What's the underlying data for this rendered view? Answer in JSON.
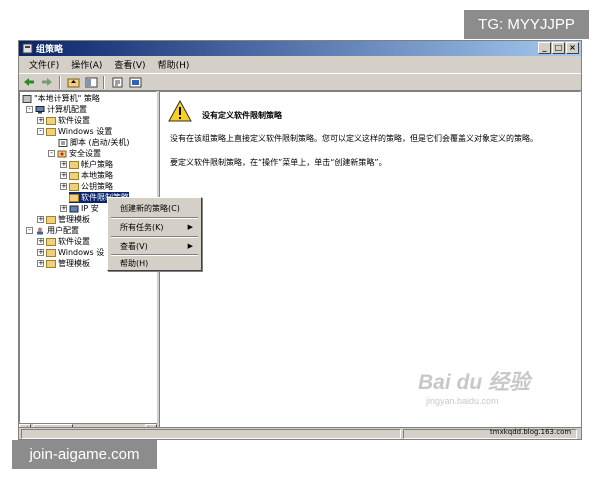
{
  "window": {
    "title": "组策略",
    "controls": [
      "_",
      "□",
      "×"
    ]
  },
  "menubar": {
    "items": [
      "文件(F)",
      "操作(A)",
      "查看(V)",
      "帮助(H)"
    ]
  },
  "toolbar": {
    "icons": [
      "back-arrow-icon",
      "forward-arrow-icon",
      "folder-up-icon",
      "show-tree-icon",
      "properties-icon",
      "help-icon"
    ]
  },
  "tree": {
    "items": [
      {
        "label": "\"本地计算机\" 策略",
        "expander": "",
        "icon": "policy-icon"
      },
      {
        "label": "计算机配置",
        "expander": "-",
        "icon": "computer-icon"
      },
      {
        "label": "软件设置",
        "expander": "+",
        "icon": "folder-icon"
      },
      {
        "label": "Windows 设置",
        "expander": "-",
        "icon": "folder-icon"
      },
      {
        "label": "脚本 (启动/关机)",
        "expander": "",
        "icon": "script-icon"
      },
      {
        "label": "安全设置",
        "expander": "-",
        "icon": "security-icon"
      },
      {
        "label": "帐户策略",
        "expander": "+",
        "icon": "folder-icon"
      },
      {
        "label": "本地策略",
        "expander": "+",
        "icon": "folder-icon"
      },
      {
        "label": "公钥策略",
        "expander": "+",
        "icon": "folder-icon"
      },
      {
        "label": "软件限制策略",
        "expander": "",
        "icon": "folder-icon",
        "selected": true
      },
      {
        "label": "IP 安",
        "expander": "+",
        "icon": "ip-security-icon"
      },
      {
        "label": "管理模板",
        "expander": "+",
        "icon": "folder-icon"
      },
      {
        "label": "用户配置",
        "expander": "-",
        "icon": "user-icon"
      },
      {
        "label": "软件设置",
        "expander": "+",
        "icon": "folder-icon"
      },
      {
        "label": "Windows 设",
        "expander": "+",
        "icon": "folder-icon"
      },
      {
        "label": "管理模板",
        "expander": "+",
        "icon": "folder-icon"
      }
    ]
  },
  "content": {
    "title": "没有定义软件限制策略",
    "paragraph1": "没有在该组策略上直接定义软件限制策略。您可以定义这样的策略，但是它们会覆盖义对象定义的策略。",
    "paragraph2": "要定义软件限制策略，在“操作”菜单上，单击“创建新策略”。"
  },
  "context_menu": {
    "items": [
      {
        "label": "创建新的策略(C)",
        "submenu": false
      },
      {
        "label": "所有任务(K)",
        "submenu": true
      },
      {
        "label": "查看(V)",
        "submenu": true
      },
      {
        "label": "帮助(H)",
        "submenu": false
      }
    ]
  },
  "overlays": {
    "tg_badge": "TG: MYYJJPP",
    "site_badge": "join-aigame.com",
    "watermark_main": "Bai du 经验",
    "watermark_sub": "jingyan.baidu.com",
    "blog_url": "tmxkqdd.blog.163.com"
  },
  "colors": {
    "titlebar": "#0a246a",
    "selection": "#0a246a",
    "chrome": "#d4d0c8",
    "badge": "#8c8c8c"
  }
}
